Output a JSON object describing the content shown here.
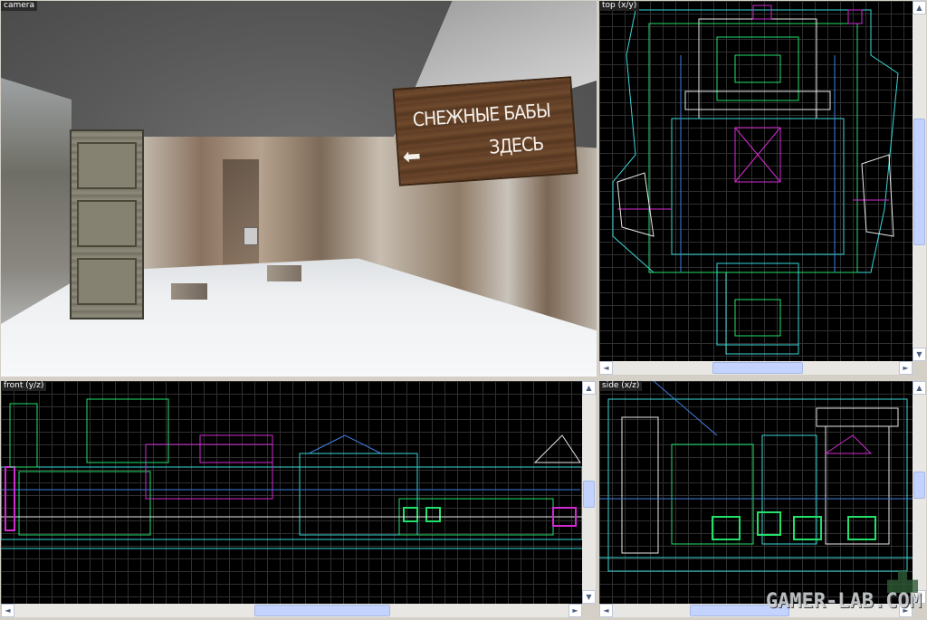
{
  "viewports": {
    "camera": {
      "label": "camera"
    },
    "top": {
      "label": "top (x/y)"
    },
    "front": {
      "label": "front (y/z)"
    },
    "side": {
      "label": "side (x/z)"
    }
  },
  "sign": {
    "line1": "СНЕЖНЫЕ БАБЫ",
    "line2": "ЗДЕСЬ",
    "arrow": "⬅"
  },
  "scrollbar": {
    "up": "▲",
    "down": "▼",
    "left": "◄",
    "right": "►"
  },
  "watermark": "GAMER-LAB.COM",
  "colors": {
    "grid": "#2f2f2f",
    "grid_major": "#1a3a6a",
    "brush_cyan": "#3ad7d7",
    "brush_green": "#22e06a",
    "brush_magenta": "#d22ad2",
    "brush_white": "#e8e8e8",
    "brush_blue": "#3f7fe0"
  }
}
